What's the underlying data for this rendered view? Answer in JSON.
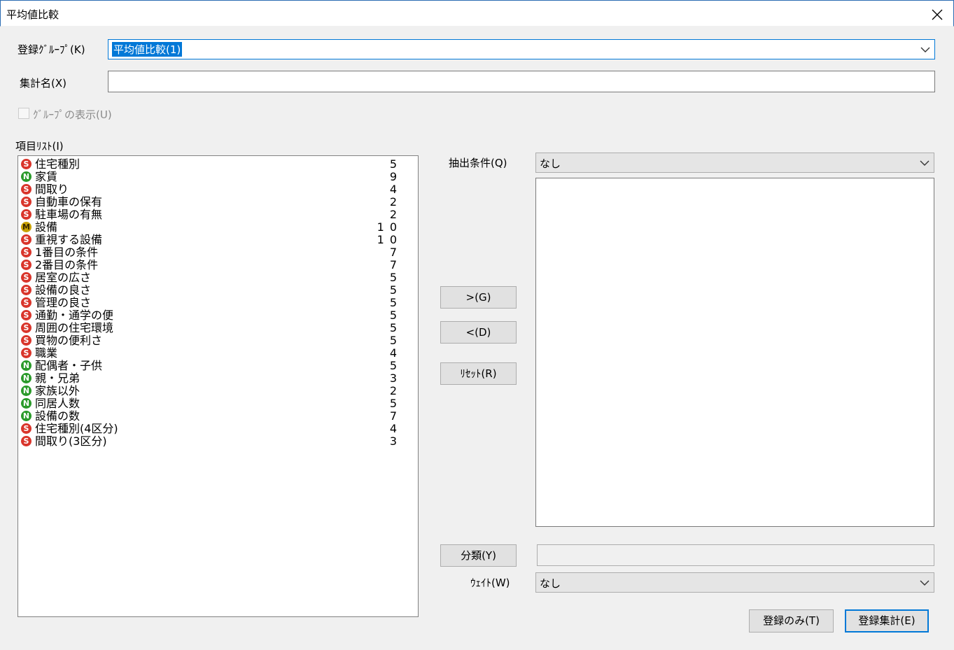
{
  "window": {
    "title": "平均値比較"
  },
  "group_label": "登録ｸﾞﾙｰﾌﾟ(K)",
  "group_value": "平均値比較(1)",
  "aggregate_label": "集計名(X)",
  "aggregate_value": "",
  "show_group_label": "ｸﾞﾙｰﾌﾟの表示(U)",
  "item_list_label": "項目ﾘｽﾄ(I)",
  "items": [
    {
      "type": "S",
      "name": "住宅種別",
      "count": "5"
    },
    {
      "type": "N",
      "name": "家賃",
      "count": "9"
    },
    {
      "type": "S",
      "name": "間取り",
      "count": "4"
    },
    {
      "type": "S",
      "name": "自動車の保有",
      "count": "2"
    },
    {
      "type": "S",
      "name": "駐車場の有無",
      "count": "2"
    },
    {
      "type": "M",
      "name": "設備",
      "count": "10"
    },
    {
      "type": "S",
      "name": "重視する設備",
      "count": "10"
    },
    {
      "type": "S",
      "name": "1番目の条件",
      "count": "7"
    },
    {
      "type": "S",
      "name": "2番目の条件",
      "count": "7"
    },
    {
      "type": "S",
      "name": "居室の広さ",
      "count": "5"
    },
    {
      "type": "S",
      "name": "設備の良さ",
      "count": "5"
    },
    {
      "type": "S",
      "name": "管理の良さ",
      "count": "5"
    },
    {
      "type": "S",
      "name": "通勤・通学の便",
      "count": "5"
    },
    {
      "type": "S",
      "name": "周囲の住宅環境",
      "count": "5"
    },
    {
      "type": "S",
      "name": "買物の便利さ",
      "count": "5"
    },
    {
      "type": "S",
      "name": "職業",
      "count": "4"
    },
    {
      "type": "N",
      "name": "配偶者・子供",
      "count": "5"
    },
    {
      "type": "N",
      "name": "親・兄弟",
      "count": "3"
    },
    {
      "type": "N",
      "name": "家族以外",
      "count": "2"
    },
    {
      "type": "N",
      "name": "同居人数",
      "count": "5"
    },
    {
      "type": "N",
      "name": "設備の数",
      "count": "7"
    },
    {
      "type": "S",
      "name": "住宅種別(4区分)",
      "count": "4"
    },
    {
      "type": "S",
      "name": "間取り(3区分)",
      "count": "3"
    }
  ],
  "badge_letters": {
    "S": "S",
    "N": "N",
    "M": "M"
  },
  "extract_label": "抽出条件(Q)",
  "extract_value": "なし",
  "buttons": {
    "add": ">(G)",
    "remove": "<(D)",
    "reset": "ﾘｾｯﾄ(R)",
    "classify": "分類(Y)",
    "register_only": "登録のみ(T)",
    "register_aggregate": "登録集計(E)"
  },
  "classify_value": "",
  "weight_label": "ｳｪｲﾄ(W)",
  "weight_value": "なし",
  "colors": {
    "accent": "#0078d7",
    "badge_S": "#d9352b",
    "badge_N": "#2a9a2a",
    "badge_M": "#c8a000"
  }
}
